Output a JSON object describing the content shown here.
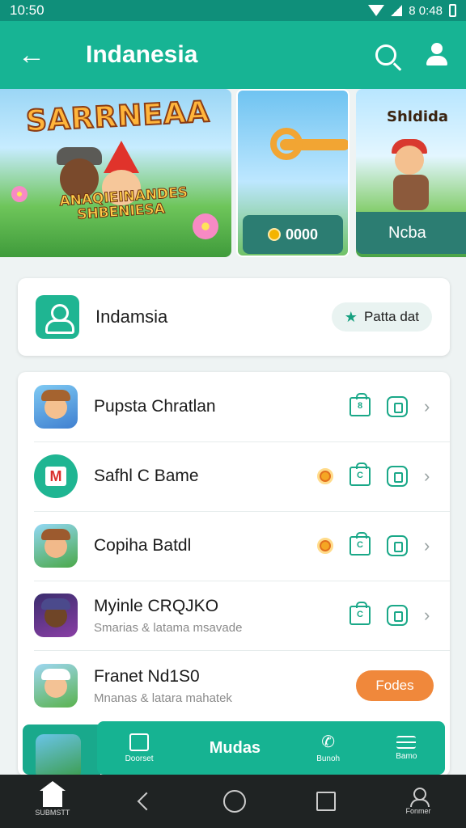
{
  "status": {
    "time": "10:50",
    "right_text": "8 0:48"
  },
  "appbar": {
    "title": "Indanesia"
  },
  "banners": {
    "main_title": "SARRNEAA",
    "main_sub": "ANAQIEINANDES SHBENIESA",
    "middle_pill": "0000",
    "right_title": "Shldida",
    "right_pill": "Ncba"
  },
  "profile": {
    "name": "Indamsia",
    "button_label": "Patta dat"
  },
  "list": [
    {
      "title": "Pupsta Chratlan",
      "subtitle": ""
    },
    {
      "title": "Safhl C Bame",
      "subtitle": ""
    },
    {
      "title": "Copiha Batdl",
      "subtitle": ""
    },
    {
      "title": "Myinle CRQJKO",
      "subtitle": "Smarias & latama msavade"
    },
    {
      "title": "Franet Nd1S0",
      "subtitle": "Mnanas & latara mahatek",
      "action": "Fodes"
    }
  ],
  "bottom_nav": {
    "items": [
      {
        "label": "Doorset"
      },
      {
        "label": "Mudas"
      },
      {
        "label": "Bunoh"
      },
      {
        "label": "Bamo"
      }
    ]
  },
  "system_bar": {
    "home_label": "SUBMSTT",
    "profile_label": "Fonmer"
  },
  "colors": {
    "primary": "#17b494",
    "dark_primary": "#0f8f7a",
    "accent": "#f0883b"
  }
}
